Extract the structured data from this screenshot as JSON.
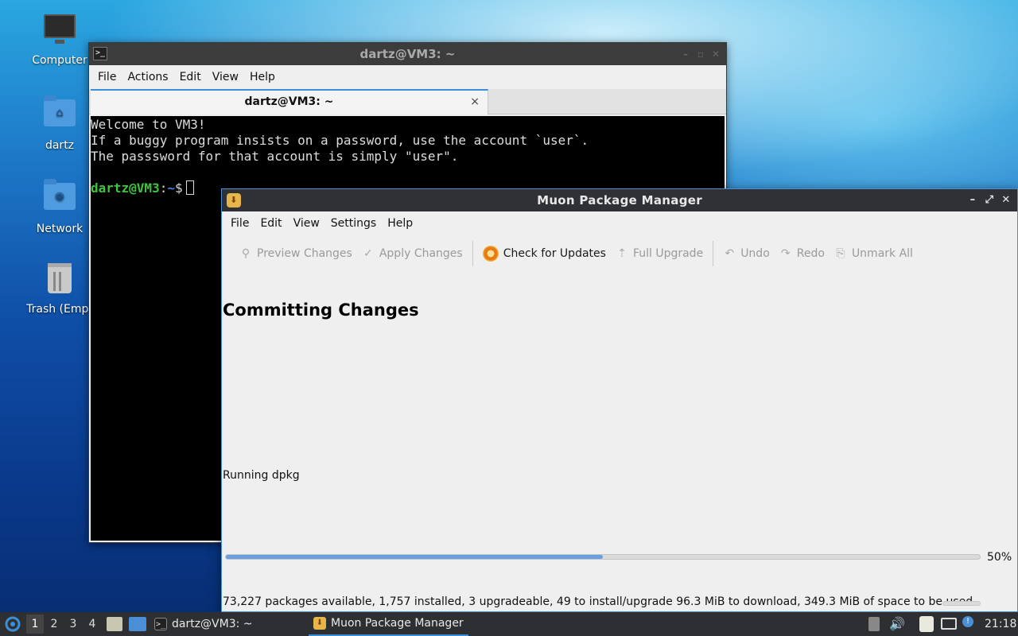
{
  "desktop": {
    "icons": [
      {
        "label": "Computer",
        "icon": "computer-icon"
      },
      {
        "label": "dartz",
        "icon": "home-folder-icon"
      },
      {
        "label": "Network",
        "icon": "network-folder-icon"
      },
      {
        "label": "Trash (Empt",
        "icon": "trash-icon"
      }
    ]
  },
  "terminal": {
    "title": "dartz@VM3: ~",
    "menu": [
      "File",
      "Actions",
      "Edit",
      "View",
      "Help"
    ],
    "tab_label": "dartz@VM3: ~",
    "tab_close": "×",
    "lines": [
      "Welcome to VM3!",
      "If a buggy program insists on a password, use the account `user`.",
      "The passsword for that account is simply \"user\"."
    ],
    "prompt_user": "dartz@VM3",
    "prompt_sep": ":",
    "prompt_path": "~",
    "prompt_symbol": "$"
  },
  "muon": {
    "title": "Muon Package Manager",
    "menu": [
      "File",
      "Edit",
      "View",
      "Settings",
      "Help"
    ],
    "toolbar": [
      {
        "label": "Preview Changes",
        "icon": "search-icon",
        "enabled": false
      },
      {
        "label": "Apply Changes",
        "icon": "checkmark-icon",
        "enabled": false
      },
      {
        "label": "Check for Updates",
        "icon": "refresh-icon",
        "enabled": true
      },
      {
        "label": "Full Upgrade",
        "icon": "upgrade-icon",
        "enabled": false
      },
      {
        "label": "Undo",
        "icon": "undo-icon",
        "enabled": false
      },
      {
        "label": "Redo",
        "icon": "redo-icon",
        "enabled": false
      },
      {
        "label": "Unmark All",
        "icon": "unmark-icon",
        "enabled": false
      }
    ],
    "heading": "Committing Changes",
    "status": "Running dpkg",
    "progress": 0.5,
    "progress_label": "50%",
    "statusbar": "73,227 packages available, 1,757 installed, 3 upgradeable, 49 to install/upgrade 96.3 MiB to download, 349.3 MiB of space to be used"
  },
  "taskbar": {
    "workspaces": [
      "1",
      "2",
      "3",
      "4"
    ],
    "tasks": [
      {
        "label": "dartz@VM3: ~",
        "icon": "terminal-icon"
      },
      {
        "label": "Muon Package Manager",
        "icon": "package-icon"
      }
    ],
    "clock": "21:18"
  },
  "colors": {
    "accent": "#3b8fd9",
    "terminal_prompt_user": "#3ec43e",
    "terminal_prompt_path": "#4a7dd6"
  }
}
